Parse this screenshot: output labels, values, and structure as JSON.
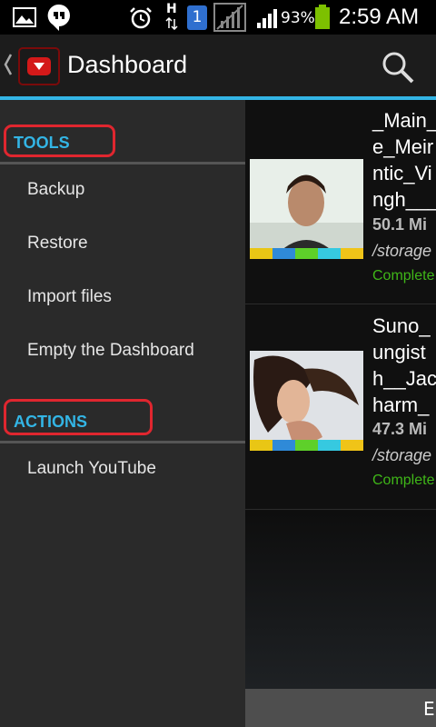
{
  "status_bar": {
    "battery_percent": "93%",
    "time": "2:59 AM",
    "sim_badge": "1",
    "network_letter": "H",
    "icons": [
      "gallery-icon",
      "hangouts-icon",
      "alarm-icon",
      "data-transfer-icon",
      "sim-icon",
      "no-signal-icon",
      "signal-icon",
      "battery-icon"
    ]
  },
  "action_bar": {
    "title": "Dashboard",
    "icons": [
      "back-chevron-icon",
      "app-logo-icon",
      "search-icon"
    ]
  },
  "drawer": {
    "tools_header": "TOOLS",
    "tools_items": [
      "Backup",
      "Restore",
      "Import files",
      "Empty the Dashboard"
    ],
    "actions_header": "ACTIONS",
    "actions_items": [
      "Launch YouTube"
    ],
    "annotation_color": "#e0262f"
  },
  "videos": [
    {
      "title_lines": "_Main_\ne_Meir\nntic_Vi\nngh___",
      "size": "50.1 Mi",
      "path": "/storage",
      "status": "Complete"
    },
    {
      "title_lines": "Suno_\nungist\nh__Jac\nharm_",
      "size": "47.3 Mi",
      "path": "/storage",
      "status": "Complete"
    }
  ],
  "bottom_bar": {
    "label": "E"
  },
  "colors": {
    "accent": "#33b5e5",
    "status_green": "#3fb618",
    "drawer_bg": "#2a2a2a"
  }
}
